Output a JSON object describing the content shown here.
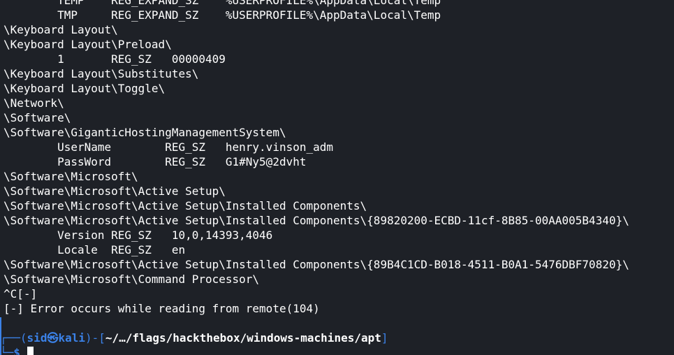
{
  "terminal": {
    "lines": [
      "        TEMP    REG_EXPAND_SZ    %USERPROFILE%\\AppData\\Local\\Temp",
      "        TMP     REG_EXPAND_SZ    %USERPROFILE%\\AppData\\Local\\Temp",
      "\\Keyboard Layout\\",
      "\\Keyboard Layout\\Preload\\",
      "        1       REG_SZ   00000409",
      "\\Keyboard Layout\\Substitutes\\",
      "\\Keyboard Layout\\Toggle\\",
      "\\Network\\",
      "\\Software\\",
      "\\Software\\GiganticHostingManagementSystem\\",
      "        UserName        REG_SZ   henry.vinson_adm",
      "        PassWord        REG_SZ   G1#Ny5@2dvht",
      "\\Software\\Microsoft\\",
      "\\Software\\Microsoft\\Active Setup\\",
      "\\Software\\Microsoft\\Active Setup\\Installed Components\\",
      "\\Software\\Microsoft\\Active Setup\\Installed Components\\{89820200-ECBD-11cf-8B85-00AA005B4340}\\",
      "        Version REG_SZ   10,0,14393,4046",
      "        Locale  REG_SZ   en",
      "\\Software\\Microsoft\\Active Setup\\Installed Components\\{89B4C1CD-B018-4511-B0A1-5476DBF70820}\\",
      "\\Software\\Microsoft\\Command Processor\\",
      "^C[-]",
      "[-] Error occurs while reading from remote(104)",
      ""
    ]
  },
  "prompt": {
    "corner_top": "┌──",
    "open_paren": "(",
    "user": "sid",
    "skull": "㉿",
    "host": "kali",
    "close_paren": ")",
    "dash": "-",
    "open_bracket": "[",
    "path": "~/…/flags/hackthebox/windows-machines/apt",
    "close_bracket": "]",
    "corner_bottom": "└─",
    "symbol": "$"
  },
  "colors": {
    "background": "#1e2127",
    "text": "#ffffff",
    "prompt_accent": "#3b82e8"
  }
}
